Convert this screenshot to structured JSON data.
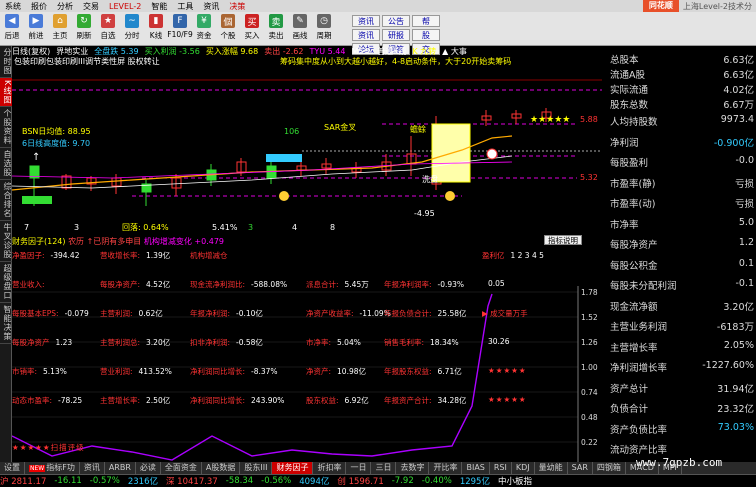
{
  "menu": {
    "items": [
      "系统",
      "报价",
      "分析",
      "交易",
      "LEVEL-2",
      "智能",
      "工具",
      "资讯",
      "决策"
    ],
    "brand": "同花顺",
    "subtitle": "上海Level-2技术分"
  },
  "toolbar": {
    "buttons": [
      {
        "label": "后退",
        "color": "#4a7bd8",
        "glyph": "◀"
      },
      {
        "label": "前进",
        "color": "#4a7bd8",
        "glyph": "▶"
      },
      {
        "label": "主页",
        "color": "#e0a030",
        "glyph": "⌂"
      },
      {
        "label": "刷新",
        "color": "#33aa33",
        "glyph": "↻"
      },
      {
        "label": "自选",
        "color": "#d04040",
        "glyph": "★"
      },
      {
        "label": "分时",
        "color": "#2288cc",
        "glyph": "~"
      },
      {
        "label": "K线",
        "color": "#cc3333",
        "glyph": "▮"
      },
      {
        "label": "F10/F9",
        "color": "#3366aa",
        "glyph": "F"
      },
      {
        "label": "资金",
        "color": "#33aa66",
        "glyph": "¥"
      },
      {
        "label": "个股",
        "color": "#aa6633",
        "glyph": "個"
      },
      {
        "label": "买入",
        "color": "#cc2222",
        "glyph": "买"
      },
      {
        "label": "卖出",
        "color": "#229944",
        "glyph": "卖"
      },
      {
        "label": "画线",
        "color": "#666666",
        "glyph": "✎"
      },
      {
        "label": "周期",
        "color": "#666666",
        "glyph": "◷"
      }
    ],
    "small": [
      "资讯",
      "公告",
      "帮",
      "资讯",
      "研报",
      "股",
      "论坛",
      "问答",
      "交"
    ]
  },
  "vtabs": [
    "分时图",
    "K线图",
    "个股资料",
    "自选股",
    "综合排名",
    "牛叉诊股",
    "超级盘口",
    "智能决策"
  ],
  "chart_header": {
    "items": [
      {
        "text": "日线(复权)",
        "color": "#fff"
      },
      {
        "text": "界地实业",
        "color": "#fff"
      },
      {
        "text": "全盘跌 5.39",
        "color": "#3cf"
      },
      {
        "text": "买入利润 -3.56",
        "color": "#3d3"
      },
      {
        "text": "买入涨幅 9.68",
        "color": "#ff0"
      },
      {
        "text": "卖出 -2.62",
        "color": "#f44"
      },
      {
        "text": "TYU 5.44",
        "color": "#f0f"
      },
      {
        "text": "M5.5",
        "color": "#fff"
      },
      {
        "text": "普通K线",
        "color": "#fff"
      },
      {
        "text": "K 九转",
        "color": "#ff0"
      },
      {
        "text": "▲ 大事",
        "color": "#fff"
      }
    ],
    "notice1": "包装印刷包装印刷III调节类性屏  股权转让",
    "notice2": "筹码集中度从小到大越小越好，4-8启动条件，大于20开始卖筹码"
  },
  "kline": {
    "price_labels": {
      "top": "5.88",
      "mid": "5.32",
      "low": "-4.95"
    },
    "annotations": [
      "BSN日均值: 88.95",
      "6日线高度值: 9.70",
      "SAR金叉",
      "106",
      "蟾蜍",
      "洗盘",
      "回落: 0.64%",
      "7",
      "5.41%",
      "3",
      "4",
      "8",
      "3"
    ]
  },
  "fin_header": {
    "title": "财务因子(124)",
    "notes": "农历 ↑已阴有多申目",
    "note2": "机构增减变化 +0.479",
    "button": "指标说明",
    "axis": [
      "1.78",
      "1.52",
      "1.26",
      "1.00",
      "0.74",
      "0.48",
      "0.22"
    ]
  },
  "fin_rows": [
    [
      {
        "l": "净盈因子:",
        "v": "-394.42"
      },
      {
        "l": "营收增长率:",
        "v": "1.39亿"
      },
      {
        "l": "机构增减仓",
        "v": ""
      },
      {
        "l": "",
        "v": ""
      },
      {
        "l": "",
        "v": ""
      },
      {
        "l": "盈利亿",
        "v": "1  2  3  4  5"
      }
    ],
    [
      {
        "l": "营业收入:",
        "v": ""
      },
      {
        "l": "每股净资产:",
        "v": "4.52亿"
      },
      {
        "l": "现金流净利润比:",
        "v": "-588.08%"
      },
      {
        "l": "派息合计:",
        "v": "5.45万"
      },
      {
        "l": "年报净利润率:",
        "v": "-0.93%"
      },
      {
        "l": "",
        "v": "0.05"
      }
    ],
    [
      {
        "l": "每股基本EPS:",
        "v": "-0.079"
      },
      {
        "l": "主营利润:",
        "v": "0.62亿"
      },
      {
        "l": "年报净利润:",
        "v": "-0.10亿"
      },
      {
        "l": "净资产收益率:",
        "v": "-11.09%"
      },
      {
        "l": "年报负债合计:",
        "v": "25.58亿"
      },
      {
        "l": "▶ 成交量万手",
        "v": ""
      }
    ],
    [
      {
        "l": "每股净资产",
        "v": "1.23"
      },
      {
        "l": "主营利润总:",
        "v": "3.20亿"
      },
      {
        "l": "扣非净利润:",
        "v": "-0.58亿"
      },
      {
        "l": "市净率:",
        "v": "5.04%"
      },
      {
        "l": "销售毛利率:",
        "v": "18.34%"
      },
      {
        "l": "",
        "v": "30.26"
      }
    ],
    [
      {
        "l": "市销率:",
        "v": "5.13%"
      },
      {
        "l": "营业利润:",
        "v": "413.52%"
      },
      {
        "l": "净利润同比增长:",
        "v": "-8.37%"
      },
      {
        "l": "净资产:",
        "v": "10.98亿"
      },
      {
        "l": "年报股东权益:",
        "v": "6.71亿"
      },
      {
        "l": "",
        "v": "★★★★★"
      }
    ],
    [
      {
        "l": "动态市盈率:",
        "v": "-78.25"
      },
      {
        "l": "主营增长率:",
        "v": "2.50亿"
      },
      {
        "l": "净利润同比增长:",
        "v": "243.90%"
      },
      {
        "l": "股东权益:",
        "v": "6.92亿"
      },
      {
        "l": "年报资产合计:",
        "v": "34.28亿"
      },
      {
        "l": "",
        "v": "★★★★★"
      }
    ]
  ],
  "fin_footer": "★★★★★扫描评级",
  "side_top": [
    {
      "k": "总股本",
      "v": "6.63亿",
      "c": "w"
    },
    {
      "k": "流通A股",
      "v": "6.63亿",
      "c": "w"
    },
    {
      "k": "实际流通",
      "v": "4.02亿",
      "c": "w"
    },
    {
      "k": "股东总数",
      "v": "6.67万",
      "c": "w"
    }
  ],
  "side_rows": [
    {
      "k": "人均持股数",
      "v": "9973.4",
      "c": "w"
    },
    {
      "k": "净利润",
      "v": "-0.900亿",
      "c": "cyan"
    },
    {
      "k": "每股盈利",
      "v": "-0.0",
      "c": "w"
    },
    {
      "k": "市盈率(静)",
      "v": "亏损",
      "c": "w"
    },
    {
      "k": "市盈率(动)",
      "v": "亏损",
      "c": "w"
    },
    {
      "k": "市净率",
      "v": "5.0",
      "c": "w"
    },
    {
      "k": "每股净资产",
      "v": "1.2",
      "c": "w"
    },
    {
      "k": "每股公积金",
      "v": "0.1",
      "c": "w"
    },
    {
      "k": "每股未分配利润",
      "v": "-0.1",
      "c": "w"
    },
    {
      "k": "现金流净额",
      "v": "3.20亿",
      "c": "w"
    },
    {
      "k": "主营业务利润",
      "v": "-6183万",
      "c": "w"
    },
    {
      "k": "主营增长率",
      "v": "2.05%",
      "c": "w"
    },
    {
      "k": "净利润增长率",
      "v": "-1227.60%",
      "c": "w"
    },
    {
      "k": "资产总计",
      "v": "31.94亿",
      "c": "w"
    },
    {
      "k": "负债合计",
      "v": "23.32亿",
      "c": "w"
    },
    {
      "k": "资产负债比率",
      "v": "73.03%",
      "c": "cyan"
    },
    {
      "k": "流动资产比率",
      "v": "",
      "c": "w"
    }
  ],
  "bottom_tabs": [
    "设置",
    "指标F功",
    "资讯",
    "ARBR",
    "必读",
    "全面资金",
    "A股数据",
    "股东III",
    "财务因子",
    "折扣率",
    "一日",
    "三日",
    "去数字",
    "开比率",
    "BIAS",
    "RSI",
    "KDJ",
    "量幼能",
    "SAR",
    "四钢箱",
    "MACD",
    "MFI"
  ],
  "status": [
    {
      "t": "沪 2811.17",
      "c": "sr"
    },
    {
      "t": "-16.11",
      "c": "sg"
    },
    {
      "t": "-0.57%",
      "c": "sg"
    },
    {
      "t": "2316亿",
      "c": "sb"
    },
    {
      "t": "深 10417.37",
      "c": "sr"
    },
    {
      "t": "-58.34",
      "c": "sg"
    },
    {
      "t": "-0.56%",
      "c": "sg"
    },
    {
      "t": "4094亿",
      "c": "sb"
    },
    {
      "t": "创 1596.71",
      "c": "sr"
    },
    {
      "t": "-7.92",
      "c": "sg"
    },
    {
      "t": "-0.40%",
      "c": "sg"
    },
    {
      "t": "1295亿",
      "c": "sb"
    },
    {
      "t": "中小板指",
      "c": "sw"
    }
  ],
  "watermark": "www.7gpzb.com",
  "colors": {
    "up": "#ff3333",
    "down": "#33dd33",
    "accent": "#c00000"
  }
}
